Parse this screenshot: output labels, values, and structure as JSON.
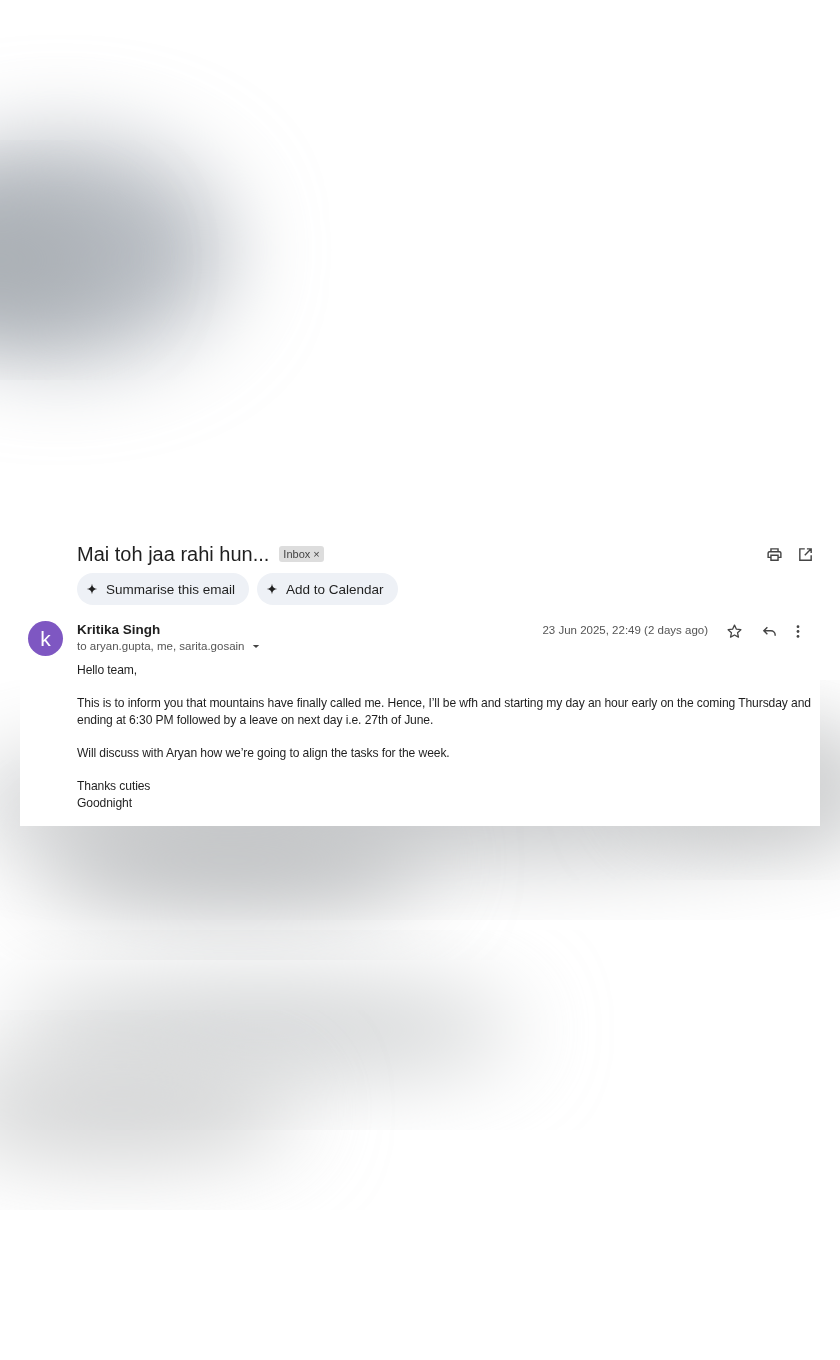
{
  "subject": {
    "title": "Mai toh jaa rahi hun...",
    "label": "Inbox",
    "label_remove": "×"
  },
  "actions": [
    {
      "label": "Summarise this email"
    },
    {
      "label": "Add to Calendar"
    }
  ],
  "message": {
    "avatar_letter": "k",
    "sender": "Kritika Singh",
    "recipients": "to aryan.gupta, me, sarita.gosain",
    "date": "23 Jun 2025, 22:49 (2 days ago)",
    "starred": false,
    "paragraphs": [
      [
        "Hello team,"
      ],
      [
        "This is to inform you that mountains have finally called me. Hence, I’ll be wfh and starting my day an hour early on the coming Thursday and ending at 6:30 PM followed by a leave on next day i.e. 27th of June."
      ],
      [
        "Will discuss with Aryan how we’re going to align the tasks for the week."
      ],
      [
        "Thanks cuties",
        "Goodnight"
      ]
    ]
  }
}
